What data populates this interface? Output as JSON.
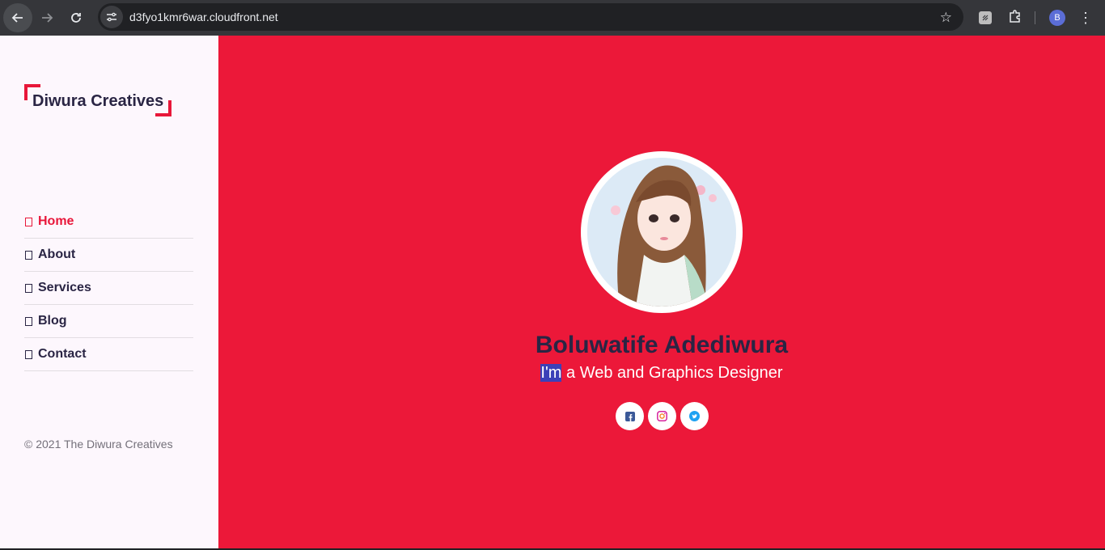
{
  "browser": {
    "url": "d3fyo1kmr6war.cloudfront.net",
    "profile_initial": "B"
  },
  "sidebar": {
    "logo": "Diwura Creatives",
    "nav": [
      {
        "label": "Home",
        "active": true
      },
      {
        "label": "About",
        "active": false
      },
      {
        "label": "Services",
        "active": false
      },
      {
        "label": "Blog",
        "active": false
      },
      {
        "label": "Contact",
        "active": false
      }
    ],
    "copyright": "© 2021 The Diwura Creatives"
  },
  "hero": {
    "name": "Boluwatife Adediwura",
    "tagline_highlight": "I'm",
    "tagline_rest": " a Web and Graphics Designer",
    "socials": [
      {
        "icon": "facebook-icon",
        "color": "#3b5998"
      },
      {
        "icon": "instagram-icon",
        "color": "#d6249f"
      },
      {
        "icon": "twitter-icon",
        "color": "#1da1f2"
      }
    ]
  },
  "colors": {
    "accent": "#ec1839",
    "dark_text": "#2a2544",
    "sidebar_bg": "#fdf7fd"
  }
}
